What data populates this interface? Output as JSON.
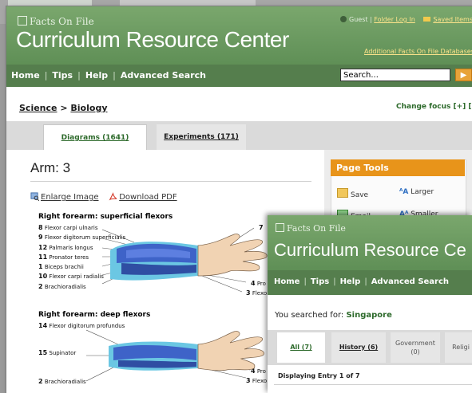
{
  "back_window": {
    "logo_text": "Facts On File",
    "brand": "Curriculum Resource Center",
    "user": {
      "guest_label": "Guest",
      "folder_login": "Folder Log In",
      "saved_items": "Saved Items"
    },
    "additional_link": "Additional Facts On File Databases",
    "nav": [
      "Home",
      "Tips",
      "Help",
      "Advanced Search"
    ],
    "search": {
      "placeholder": "Search...",
      "go_label": "▶"
    },
    "breadcrumb": {
      "subject": "Science",
      "separator": ">",
      "topic": "Biology"
    },
    "change_focus": "Change focus [+] [–]",
    "tabs": [
      {
        "label": "Diagrams (1641)",
        "active": true
      },
      {
        "label": "Experiments (171)",
        "active": false
      }
    ],
    "item_title": "Arm: 3",
    "actions": {
      "enlarge": "Enlarge Image",
      "download": "Download PDF"
    },
    "page_tools": {
      "heading": "Page Tools",
      "items": {
        "save": "Save",
        "larger": "Larger",
        "email": "Email",
        "smaller": "Smaller"
      }
    },
    "figure": {
      "top_heading": "Right forearm: superficial flexors",
      "top_labels": [
        {
          "num": "8",
          "text": "Flexor carpi ulnaris"
        },
        {
          "num": "9",
          "text": "Flexor digitorum superficialis"
        },
        {
          "num": "12",
          "text": "Palmaris longus"
        },
        {
          "num": "11",
          "text": "Pronator teres"
        },
        {
          "num": "1",
          "text": "Biceps brachii"
        },
        {
          "num": "10",
          "text": "Flexor carpi radialis"
        },
        {
          "num": "2",
          "text": "Brachioradialis"
        }
      ],
      "top_right_labels": [
        {
          "num": "7",
          "text": ""
        },
        {
          "num": "4",
          "text": "Pro"
        },
        {
          "num": "3",
          "text": "Flexo"
        }
      ],
      "bottom_heading": "Right forearm: deep flexors",
      "bottom_labels": [
        {
          "num": "14",
          "text": "Flexor digitorum profundus"
        },
        {
          "num": "15",
          "text": "Supinator"
        },
        {
          "num": "2",
          "text": "Brachioradialis"
        }
      ],
      "bottom_right_labels": [
        {
          "num": "4",
          "text": "Pro"
        },
        {
          "num": "3",
          "text": "Flexo"
        }
      ]
    }
  },
  "front_window": {
    "logo_text": "Facts On File",
    "brand": "Curriculum Resource Ce",
    "nav": [
      "Home",
      "Tips",
      "Help",
      "Advanced Search"
    ],
    "search_prefix": "You searched for:",
    "search_term": "Singapore",
    "tabs": [
      {
        "label": "All (7)",
        "active": true
      },
      {
        "label": "History (6)",
        "active": false
      },
      {
        "label": "Government",
        "count": "(0)",
        "active": false
      },
      {
        "label": "Religi",
        "active": false
      }
    ],
    "displaying": "Displaying Entry 1 of 7"
  },
  "colors": {
    "header_green": "#6e9a62",
    "nav_green": "#557e4d",
    "link_green": "#2d6a2b",
    "page_tools_orange": "#e8941a"
  }
}
